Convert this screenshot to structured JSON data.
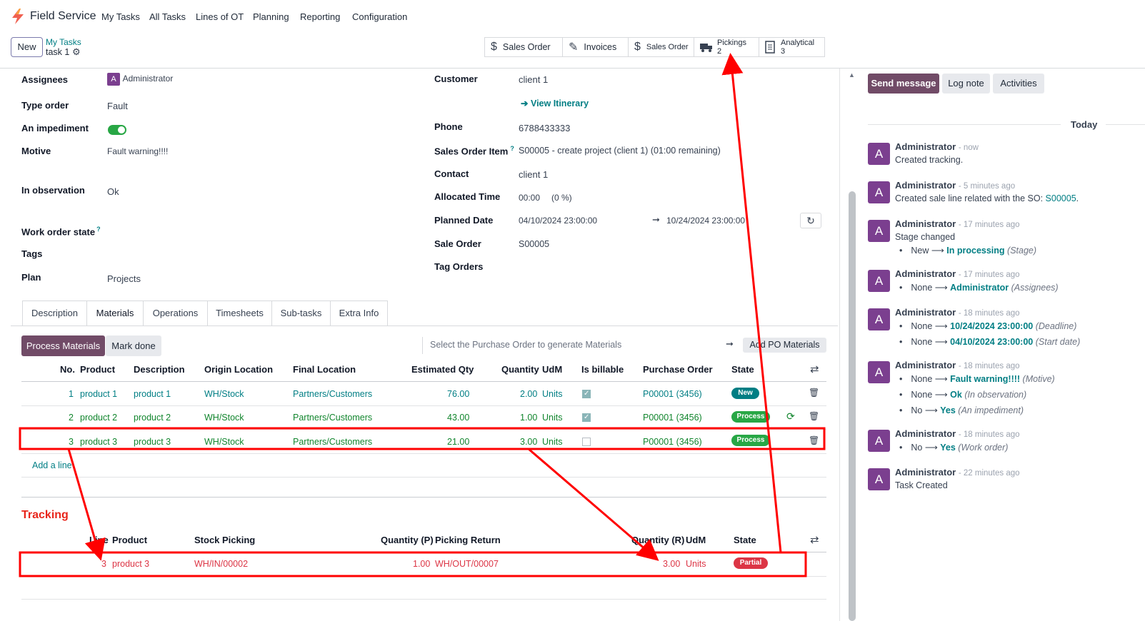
{
  "nav": {
    "app": "Field Service",
    "menus": [
      "My Tasks",
      "All Tasks",
      "Lines of OT",
      "Planning",
      "Reporting",
      "Configuration"
    ]
  },
  "control": {
    "new_label": "New",
    "breadcrumb_parent": "My Tasks",
    "breadcrumb_current": "task 1",
    "smart_buttons": [
      {
        "label": "Sales Order",
        "icon": "dollar-icon"
      },
      {
        "label": "Invoices",
        "icon": "edit-icon"
      },
      {
        "label": "Sales Order",
        "icon": "dollar-icon"
      },
      {
        "label": "Pickings",
        "count": "2",
        "icon": "truck-icon"
      },
      {
        "label": "Analytical",
        "count": "3",
        "icon": "document-icon"
      }
    ]
  },
  "form": {
    "assignees_label": "Assignees",
    "assignees_initial": "A",
    "assignees_value": "Administrator",
    "type_order_label": "Type order",
    "type_order_value": "Fault",
    "impediment_label": "An impediment",
    "motive_label": "Motive",
    "motive_value": "Fault warning!!!!",
    "observation_label": "In observation",
    "observation_value": "Ok",
    "work_order_state_label": "Work order state",
    "help_mark": "?",
    "tags_label": "Tags",
    "plan_label": "Plan",
    "plan_value": "Projects",
    "customer_label": "Customer",
    "customer_value": "client 1",
    "itinerary_label": "View Itinerary",
    "phone_label": "Phone",
    "phone_value": "6788433333",
    "so_item_label": "Sales Order Item",
    "so_item_value": "S00005 - create project (client 1) (01:00 remaining)",
    "contact_label": "Contact",
    "contact_value": "client 1",
    "allocated_label": "Allocated Time",
    "allocated_value": "00:00",
    "allocated_pct": "(0 %)",
    "planned_label": "Planned Date",
    "planned_start": "04/10/2024 23:00:00",
    "planned_end": "10/24/2024 23:00:00",
    "sale_order_label": "Sale Order",
    "sale_order_value": "S00005",
    "tag_orders_label": "Tag Orders"
  },
  "tabs": [
    "Description",
    "Materials",
    "Operations",
    "Timesheets",
    "Sub-tasks",
    "Extra Info"
  ],
  "materials": {
    "process_label": "Process Materials",
    "mark_done_label": "Mark done",
    "po_placeholder": "Select the Purchase Order to generate Materials",
    "add_po_label": "Add PO Materials",
    "headers": [
      "No.",
      "Product",
      "Description",
      "Origin Location",
      "Final Location",
      "Estimated Qty",
      "Quantity",
      "UdM",
      "Is billable",
      "Purchase Order",
      "State"
    ],
    "rows": [
      {
        "no": "1",
        "product": "product 1",
        "desc": "product 1",
        "origin": "WH/Stock",
        "final": "Partners/Customers",
        "est": "76.00",
        "qty": "2.00",
        "udm": "Units",
        "billable": true,
        "po": "P00001 (3456)",
        "state": "New"
      },
      {
        "no": "2",
        "product": "product 2",
        "desc": "product 2",
        "origin": "WH/Stock",
        "final": "Partners/Customers",
        "est": "43.00",
        "qty": "1.00",
        "udm": "Units",
        "billable": true,
        "po": "P00001 (3456)",
        "state": "Process"
      },
      {
        "no": "3",
        "product": "product 3",
        "desc": "product 3",
        "origin": "WH/Stock",
        "final": "Partners/Customers",
        "est": "21.00",
        "qty": "3.00",
        "udm": "Units",
        "billable": false,
        "po": "P00001 (3456)",
        "state": "Process"
      }
    ],
    "add_line_label": "Add a line"
  },
  "tracking": {
    "title": "Tracking",
    "headers": [
      "Line",
      "Product",
      "Stock Picking",
      "Quantity (P)",
      "Picking Return",
      "Quantity (R)",
      "UdM",
      "State"
    ],
    "row": {
      "line": "3",
      "product": "product 3",
      "picking": "WH/IN/00002",
      "qty_p": "1.00",
      "return": "WH/OUT/00007",
      "qty_r": "3.00",
      "udm": "Units",
      "state": "Partial"
    }
  },
  "chatter": {
    "send_label": "Send message",
    "log_label": "Log note",
    "activities_label": "Activities",
    "day_label": "Today",
    "author": "Administrator",
    "messages": [
      {
        "time": "- now",
        "body": "Created tracking."
      },
      {
        "time": "- 5 minutes ago",
        "body": "Created sale line related with the SO:",
        "link": "S00005",
        "tail": "."
      },
      {
        "time": "- 17 minutes ago",
        "body": "Stage changed",
        "changes": [
          {
            "old": "New",
            "new": "In processing",
            "field": "(Stage)"
          }
        ]
      },
      {
        "time": "- 17 minutes ago",
        "changes": [
          {
            "old": "None",
            "new": "Administrator",
            "field": "(Assignees)"
          }
        ]
      },
      {
        "time": "- 18 minutes ago",
        "changes": [
          {
            "old": "None",
            "new": "10/24/2024 23:00:00",
            "field": "(Deadline)"
          },
          {
            "old": "None",
            "new": "04/10/2024 23:00:00",
            "field": "(Start date)"
          }
        ]
      },
      {
        "time": "- 18 minutes ago",
        "changes": [
          {
            "old": "None",
            "new": "Fault warning!!!!",
            "field": "(Motive)"
          },
          {
            "old": "None",
            "new": "Ok",
            "field": "(In observation)"
          },
          {
            "old": "No",
            "new": "Yes",
            "field": "(An impediment)"
          }
        ]
      },
      {
        "time": "- 18 minutes ago",
        "changes": [
          {
            "old": "No",
            "new": "Yes",
            "field": "(Work order)"
          }
        ]
      },
      {
        "time": "- 22 minutes ago",
        "body": "Task Created"
      }
    ],
    "avatar_initial": "A"
  },
  "colors": {
    "primary": "#714b67",
    "annotation": "#ff0000",
    "teal": "#017e84",
    "green": "#11852d"
  }
}
